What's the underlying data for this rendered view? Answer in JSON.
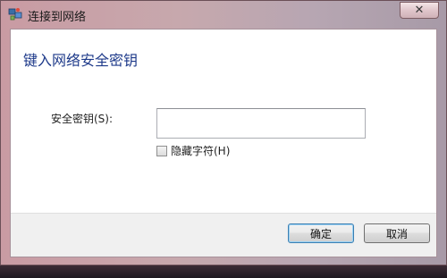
{
  "window": {
    "title": "连接到网络",
    "close_glyph": "✕"
  },
  "dialog": {
    "heading": "键入网络安全密钥",
    "security_key_label": "安全密钥(S):",
    "security_key_value": "",
    "hide_chars_label": "隐藏字符(H)",
    "hide_chars_checked": false
  },
  "buttons": {
    "ok_label": "确定",
    "cancel_label": "取消"
  },
  "colors": {
    "heading": "#1e3a8a",
    "default_button_border": "#3c7fb1"
  }
}
